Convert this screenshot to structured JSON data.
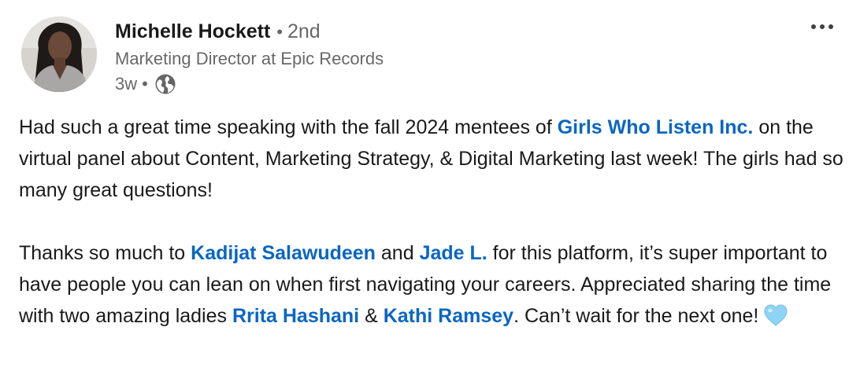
{
  "author": {
    "name": "Michelle Hockett",
    "bullet": "•",
    "degree": "2nd",
    "headline": "Marketing Director at Epic Records",
    "time": "3w",
    "time_sep": "•",
    "visibility_icon": "globe-icon"
  },
  "menu": {
    "icon": "more-options-icon"
  },
  "post": {
    "p1_part1": "Had such a great time speaking with the fall 2024 mentees of ",
    "p1_mention": "Girls Who Listen Inc.",
    "p1_part2": " on the virtual panel about Content, Marketing Strategy, & Digital Marketing last week! The girls had so many great questions!",
    "p2_part1": "Thanks so much to ",
    "p2_mention1": "Kadijat Salawudeen",
    "p2_part2": " and ",
    "p2_mention2": "Jade L.",
    "p2_part3": " for this platform, it’s super important to have people you can lean on when first navigating your careers. Appreciated sharing the time with two amazing ladies ",
    "p2_mention3": "Rrita Hashani",
    "p2_part4": " & ",
    "p2_mention4": "Kathi Ramsey",
    "p2_part5": ". Can’t wait for the next one!",
    "emoji": "light-blue-heart-icon"
  },
  "colors": {
    "link": "#0a66c2",
    "secondary_text": "#666666",
    "primary_text": "#191919"
  }
}
